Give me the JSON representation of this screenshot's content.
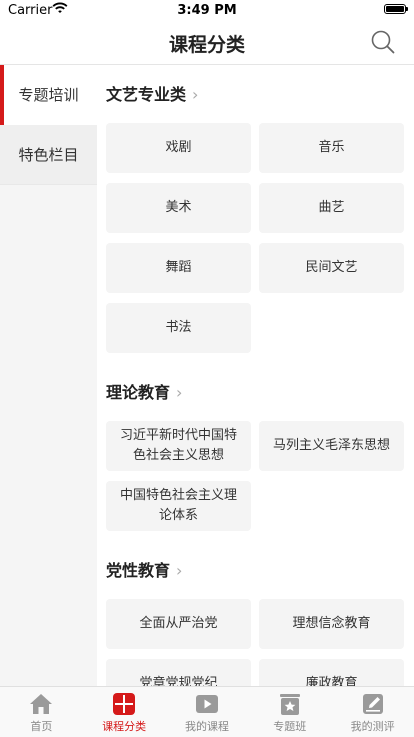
{
  "status_bar": {
    "carrier": "Carrier",
    "time": "3:49 PM"
  },
  "navbar": {
    "title": "课程分类",
    "search_icon": "search-icon"
  },
  "sidebar": {
    "items": [
      {
        "label": "专题培训",
        "active": true
      },
      {
        "label": "特色栏目",
        "active": false
      }
    ]
  },
  "sections": [
    {
      "title": "文艺专业类",
      "items": [
        "戏剧",
        "音乐",
        "美术",
        "曲艺",
        "舞蹈",
        "民间文艺",
        "书法"
      ]
    },
    {
      "title": "理论教育",
      "items": [
        "习近平新时代中国特色社会主义思想",
        "马列主义毛泽东思想",
        "中国特色社会主义理论体系"
      ]
    },
    {
      "title": "党性教育",
      "items": [
        "全面从严治党",
        "理想信念教育",
        "党章党规党纪",
        "廉政教育"
      ]
    }
  ],
  "tabbar": {
    "tabs": [
      {
        "label": "首页",
        "icon": "home-icon",
        "active": false
      },
      {
        "label": "课程分类",
        "icon": "grid-icon",
        "active": true
      },
      {
        "label": "我的课程",
        "icon": "play-icon",
        "active": false
      },
      {
        "label": "专题班",
        "icon": "star-board-icon",
        "active": false
      },
      {
        "label": "我的测评",
        "icon": "edit-icon",
        "active": false
      }
    ]
  },
  "colors": {
    "accent": "#d51a1a",
    "tile_bg": "#f4f4f4",
    "sidebar_bg": "#f5f5f5"
  }
}
